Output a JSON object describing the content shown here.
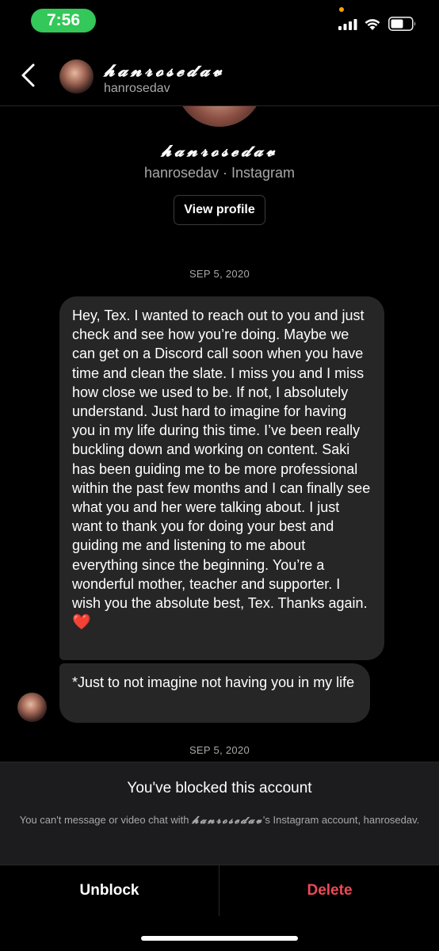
{
  "status_bar": {
    "time": "7:56",
    "time_pill_color": "#34c759"
  },
  "header": {
    "display_name": "𝓱𝓪𝓷𝓻𝓸𝓼𝓮𝓭𝓪𝓿",
    "handle": "hanrosedav"
  },
  "profile": {
    "display_name": "𝓱𝓪𝓷𝓻𝓸𝓼𝓮𝓭𝓪𝓿",
    "subtitle": "hanrosedav · Instagram",
    "view_profile_label": "View profile"
  },
  "messages": {
    "date_1": "SEP 5, 2020",
    "msg_1": "Hey, Tex. I wanted to reach out to you and just check and see how you’re doing. Maybe we can get on a Discord call soon when you have time and clean the slate. I miss you and I miss how close we used to be. If not, I absolutely understand. Just hard to imagine for having you in my life during this time. I’ve been really buckling down and working on content. Saki has been guiding me to be more professional within the past few months and I can finally see what you and her were talking about. I just want to thank you for doing your best and guiding me and listening to me about everything since the beginning. You’re a wonderful mother, teacher and supporter. I wish you the absolute best, Tex. Thanks again.",
    "msg_1_emoji": "❤️",
    "msg_2": "*Just to not imagine not having you in my life",
    "date_2": "SEP 5, 2020"
  },
  "blocked": {
    "title": "You've blocked this account",
    "desc_prefix": "You can't message or video chat with ",
    "desc_name": "𝓱𝓪𝓷𝓻𝓸𝓼𝓮𝓭𝓪𝓿",
    "desc_suffix": "'s Instagram account, hanrosedav."
  },
  "actions": {
    "unblock": "Unblock",
    "delete": "Delete"
  },
  "colors": {
    "delete": "#ed4956",
    "bubble": "#262626",
    "panel": "#1c1c1e"
  }
}
